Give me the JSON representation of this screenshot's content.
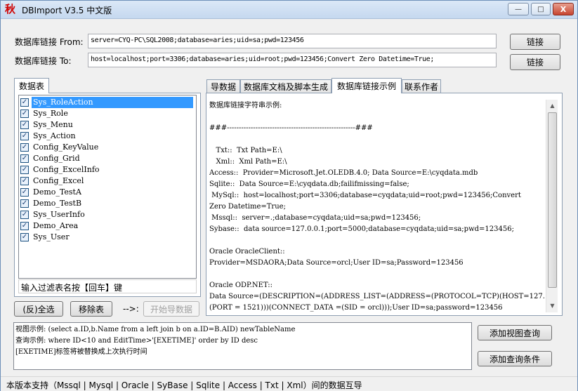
{
  "window": {
    "title": "DBImport V3.5 中文版",
    "icon_glyph": "秋",
    "minimize_glyph": "—",
    "maximize_glyph": "□",
    "close_glyph": "X"
  },
  "connections": {
    "from_label": "数据库链接 From:",
    "from_value": "server=CYQ-PC\\SQL2008;database=aries;uid=sa;pwd=123456",
    "to_label": "数据库链接 To:",
    "to_value": "host=localhost;port=3306;database=aries;uid=root;pwd=123456;Convert Zero Datetime=True;",
    "connect_button": "链接"
  },
  "tables_panel": {
    "tab_label": "数据表",
    "items": [
      {
        "name": "Sys_RoleAction",
        "checked": true,
        "selected": true
      },
      {
        "name": "Sys_Role",
        "checked": true
      },
      {
        "name": "Sys_Menu",
        "checked": true
      },
      {
        "name": "Sys_Action",
        "checked": true
      },
      {
        "name": "Config_KeyValue",
        "checked": true
      },
      {
        "name": "Config_Grid",
        "checked": true
      },
      {
        "name": "Config_ExcelInfo",
        "checked": true
      },
      {
        "name": "Config_Excel",
        "checked": true
      },
      {
        "name": "Demo_TestA",
        "checked": true
      },
      {
        "name": "Demo_TestB",
        "checked": true
      },
      {
        "name": "Sys_UserInfo",
        "checked": true
      },
      {
        "name": "Demo_Area",
        "checked": true
      },
      {
        "name": "Sys_User",
        "checked": true
      }
    ],
    "check_glyph": "✓",
    "filter_text": "输入过滤表名按【回车】键",
    "invert_select_button": "(反)全选",
    "remove_table_button": "移除表",
    "arrow_text": "-->:",
    "start_import_button": "开始导数据"
  },
  "tabs": [
    "导数据",
    "数据库文档及脚本生成",
    "数据库链接示例",
    "联系作者"
  ],
  "example": {
    "lines": [
      "数据库链接字符串示例:",
      "",
      "###------------------------------------------------------###",
      "",
      "   Txt::  Txt Path=E:\\",
      "   Xml::  Xml Path=E:\\",
      "Access::  Provider=Microsoft.Jet.OLEDB.4.0; Data Source=E:\\cyqdata.mdb",
      "Sqlite::  Data Source=E:\\cyqdata.db;failifmissing=false;",
      " MySql::  host=localhost;port=3306;database=cyqdata;uid=root;pwd=123456;Convert",
      "Zero Datetime=True;",
      " Mssql::  server=.;database=cyqdata;uid=sa;pwd=123456;",
      "Sybase::  data source=127.0.0.1;port=5000;database=cyqdata;uid=sa;pwd=123456;",
      "",
      "Oracle OracleClient::",
      "Provider=MSDAORA;Data Source=orcl;User ID=sa;Password=123456",
      "",
      "Oracle ODP.NET::",
      "Data Source=(DESCRIPTION=(ADDRESS_LIST=(ADDRESS=(PROTOCOL=TCP)(HOST=127.0.0.1)",
      "(PORT = 1521)))(CONNECT_DATA =(SID = orcl)));User ID=sa;password=123456"
    ],
    "scroll_up_glyph": "▲",
    "scroll_down_glyph": "▼"
  },
  "sql": {
    "lines": [
      "视图示例: (select a.ID,b.Name from a left join b on a.ID=B.AID) newTableName",
      "查询示例: where ID<10 and EditTime>'[EXETIME]' order by ID desc",
      "[EXETIME]标签将被替换成上次执行时间"
    ],
    "add_view_query_button": "添加视图查询",
    "add_query_condition_button": "添加查询条件"
  },
  "status": {
    "text": "本版本支持（Mssql | Mysql | Oracle | SyBase | Sqlite | Access | Txt | Xml）间的数据互导"
  }
}
